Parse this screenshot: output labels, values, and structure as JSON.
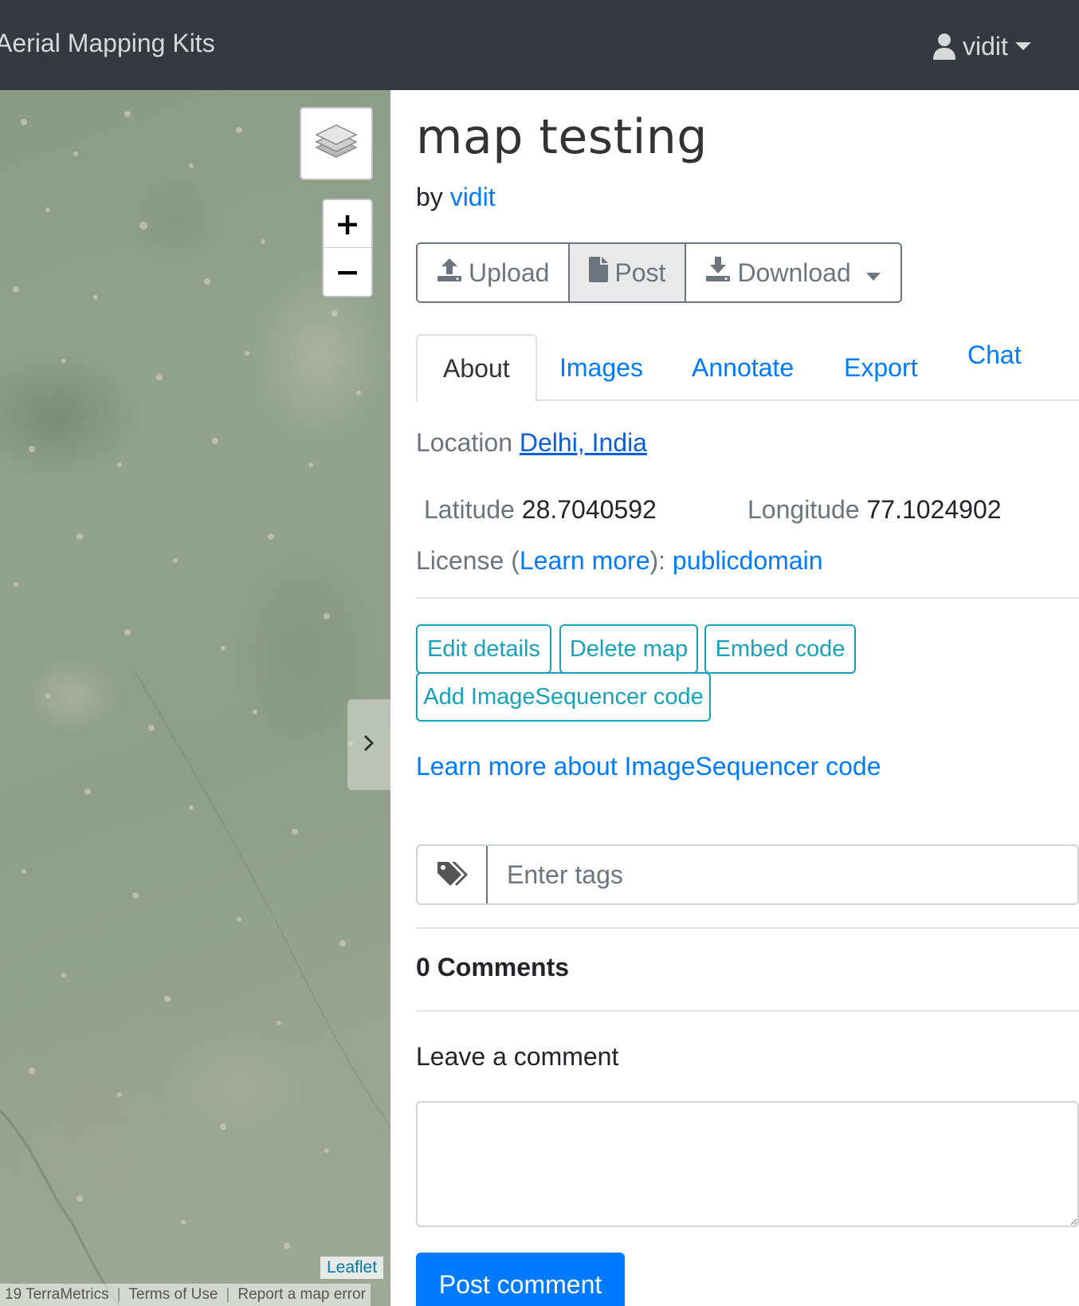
{
  "navbar": {
    "brand": "Aerial Mapping Kits",
    "user": "vidit"
  },
  "map": {
    "zoom_in": "+",
    "zoom_out": "−",
    "leaflet": "Leaflet",
    "attribution": [
      "19 TerraMetrics",
      "Terms of Use",
      "Report a map error"
    ]
  },
  "page": {
    "title": "map testing",
    "by_label": "by",
    "author": "vidit"
  },
  "actions": {
    "upload": "Upload",
    "post": "Post",
    "download": "Download"
  },
  "tabs": [
    "About",
    "Images",
    "Annotate",
    "Export",
    "Chat"
  ],
  "about": {
    "location_label": "Location",
    "location_value": "Delhi, India",
    "latitude_label": "Latitude",
    "latitude_value": "28.7040592",
    "longitude_label": "Longitude",
    "longitude_value": "77.1024902",
    "license_label": "License (",
    "license_learn": "Learn more",
    "license_sep": "):",
    "license_value": "publicdomain"
  },
  "buttons": {
    "edit": "Edit details",
    "delete": "Delete map",
    "embed": "Embed code",
    "add_sequencer": "Add ImageSequencer code"
  },
  "learn_sequencer": "Learn more about ImageSequencer code",
  "tags": {
    "placeholder": "Enter tags"
  },
  "comments": {
    "count_label": "0 Comments",
    "leave_label": "Leave a comment",
    "post_button": "Post comment"
  }
}
